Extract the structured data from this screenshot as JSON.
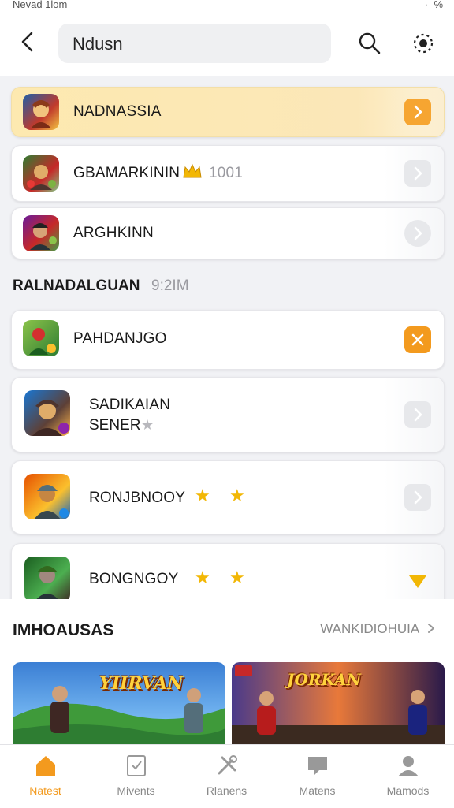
{
  "status_bar": {
    "left": "Nevad 1lom",
    "right": "· % "
  },
  "header": {
    "search_value": "Ndusn"
  },
  "list": {
    "items": [
      {
        "title": "NADNASSIA"
      },
      {
        "title": "GBAMARKININ",
        "badge": "1001"
      },
      {
        "title": "ARGHKINN"
      }
    ],
    "section_label": "RALNADALGUAN",
    "section_time": "9:2IM",
    "items2": [
      {
        "title": "PAHDANJGO"
      },
      {
        "title": "SADIKAIAN",
        "subtitle": "SENER"
      },
      {
        "title": "RONJBNOOY"
      },
      {
        "title": "BONGNGOY"
      }
    ]
  },
  "promo": {
    "title": "IMHOAUSAS",
    "link": "WANKIDIOHUIA",
    "banner1_logo": "YIIRVAN",
    "banner2_logo": "JORKAN"
  },
  "tabs": [
    {
      "label": "Natest"
    },
    {
      "label": "Mivents"
    },
    {
      "label": "Rlanens"
    },
    {
      "label": "Matens"
    },
    {
      "label": "Mamods"
    }
  ],
  "colors": {
    "accent": "#f39a1e",
    "highlight": "#fde9b0"
  }
}
